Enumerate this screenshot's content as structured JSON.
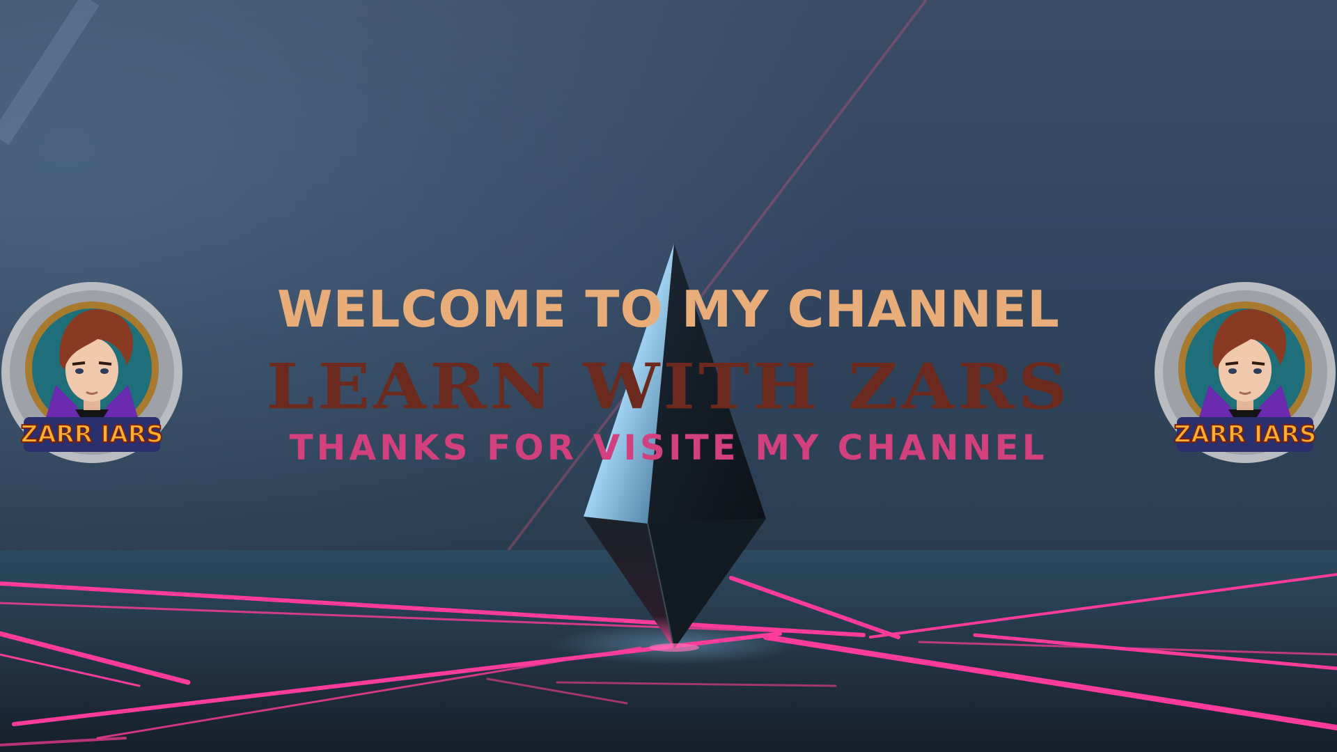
{
  "banner": {
    "welcome_text": "WELCOME TO MY CHANNEL",
    "title_text": "LEARN WITH ZARS",
    "thanks_text": "THANKS FOR VISITE MY CHANNEL",
    "logo_text": "ZARR IARS"
  },
  "colors": {
    "welcome": "#e8ad78",
    "title": "#6b2a1d",
    "thanks": "#d2407d",
    "neon": "#ff3c9a",
    "background": "#2f4256"
  },
  "icons": [
    "avatar-logo-icon",
    "crystal-prism-icon",
    "neon-laser-lines"
  ]
}
